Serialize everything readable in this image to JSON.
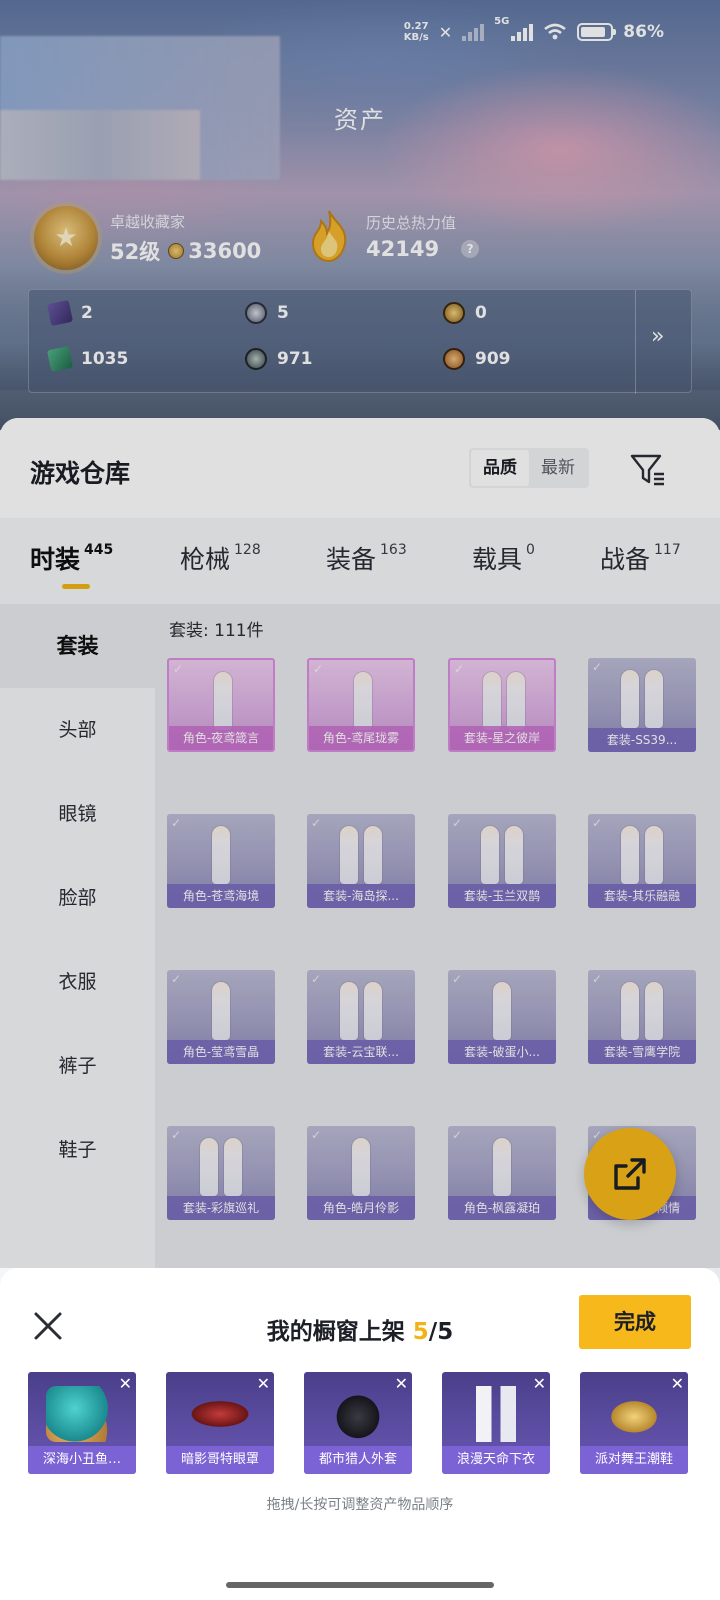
{
  "status_bar": {
    "speed_value": "0.27",
    "speed_unit": "KB/s",
    "network": "5G",
    "battery": "86%",
    "battery_level": 0.86
  },
  "header": {
    "title": "资产",
    "collector_label": "卓越收藏家",
    "collector_level": "52级",
    "collector_points": "33600",
    "heat_label": "历史总热力值",
    "heat_value": "42149",
    "help_icon": "?"
  },
  "currencies": [
    {
      "icon": "card-purple-icon",
      "value": "2"
    },
    {
      "icon": "silver-coin-icon",
      "value": "5"
    },
    {
      "icon": "gold-coin-icon",
      "value": "0"
    },
    {
      "icon": "card-green-icon",
      "value": "1035"
    },
    {
      "icon": "dark-coin-icon",
      "value": "971"
    },
    {
      "icon": "bronze-coin-icon",
      "value": "909"
    }
  ],
  "currency_more": "»",
  "warehouse": {
    "title": "游戏仓库",
    "sort_options": [
      "品质",
      "最新"
    ],
    "sort_active": "品质"
  },
  "category_tabs": [
    {
      "name": "时装",
      "count": "445"
    },
    {
      "name": "枪械",
      "count": "128"
    },
    {
      "name": "装备",
      "count": "163"
    },
    {
      "name": "载具",
      "count": "0"
    },
    {
      "name": "战备",
      "count": "117"
    }
  ],
  "side_nav": [
    "套装",
    "头部",
    "眼镜",
    "脸部",
    "衣服",
    "裤子",
    "鞋子"
  ],
  "grid_caption": "套装: 111件",
  "grid_items": [
    {
      "label": "角色-夜鸢箴言",
      "rarity": "pink"
    },
    {
      "label": "角色-鸢尾珑雾",
      "rarity": "pink"
    },
    {
      "label": "套装-星之彼岸",
      "rarity": "pink"
    },
    {
      "label": "套装-SS39...",
      "rarity": "purple"
    },
    {
      "label": "角色-苍鸢海境",
      "rarity": "purple"
    },
    {
      "label": "套装-海岛探...",
      "rarity": "purple"
    },
    {
      "label": "套装-玉兰双鹊",
      "rarity": "purple"
    },
    {
      "label": "套装-其乐融融",
      "rarity": "purple"
    },
    {
      "label": "角色-莹鸢雪晶",
      "rarity": "purple"
    },
    {
      "label": "套装-云宝联...",
      "rarity": "purple"
    },
    {
      "label": "套装-破蛋小...",
      "rarity": "purple"
    },
    {
      "label": "套装-雪鹰学院",
      "rarity": "purple"
    },
    {
      "label": "套装-彩旗巡礼",
      "rarity": "purple"
    },
    {
      "label": "角色-皓月伶影",
      "rarity": "purple"
    },
    {
      "label": "角色-枫露凝珀",
      "rarity": "purple"
    },
    {
      "label": "套装-夏日倾情",
      "rarity": "purple"
    }
  ],
  "showcase": {
    "title": "我的橱窗上架",
    "current": "5",
    "separator": "/",
    "total": "5",
    "done_label": "完成",
    "hint": "拖拽/长按可调整资产物品顺序",
    "items": [
      {
        "label": "深海小丑鱼…",
        "icon": "wig-icon"
      },
      {
        "label": "暗影哥特眼罩",
        "icon": "mask-icon"
      },
      {
        "label": "都市猎人外套",
        "icon": "jacket-icon"
      },
      {
        "label": "浪漫天命下衣",
        "icon": "pants-icon"
      },
      {
        "label": "派对舞王潮鞋",
        "icon": "shoes-icon"
      }
    ]
  },
  "colors": {
    "accent": "#f6b81a",
    "rarity_pink": "#d98fe0",
    "rarity_purple": "#7d64d7"
  }
}
